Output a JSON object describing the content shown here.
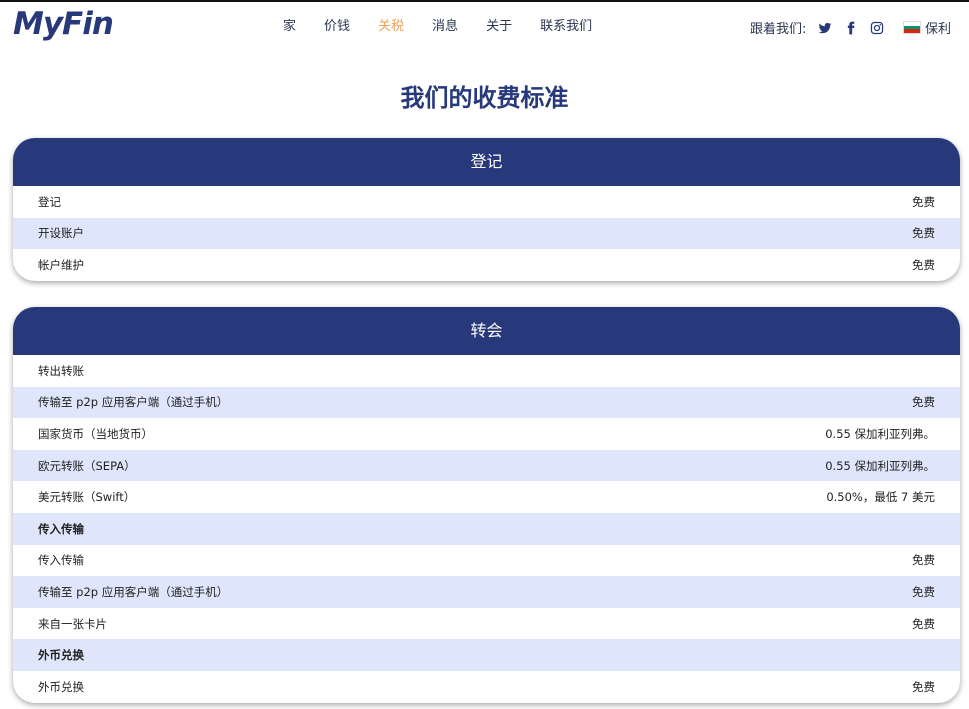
{
  "brand": {
    "logo": "MyFin"
  },
  "nav": {
    "items": [
      "家",
      "价钱",
      "关税",
      "消息",
      "关于",
      "联系我们"
    ],
    "active_index": 2
  },
  "follow": {
    "label": "跟着我们:",
    "icons": [
      "twitter-icon",
      "facebook-icon",
      "instagram-icon"
    ]
  },
  "language": {
    "label": "保利",
    "flag_colors": [
      "#ffffff",
      "#00966e",
      "#d62612"
    ]
  },
  "page": {
    "title": "我们的收费标准"
  },
  "colors": {
    "brand": "#27397a",
    "active_nav": "#f0a35a",
    "row_alt": "#dfe6fb"
  },
  "cards": [
    {
      "title": "登记",
      "rows": [
        {
          "label": "登记",
          "value": "免费"
        },
        {
          "label": "开设账户",
          "value": "免费"
        },
        {
          "label": "帐户维护",
          "value": "免费"
        }
      ]
    },
    {
      "title": "转会",
      "rows": [
        {
          "label": "转出转账",
          "value": "",
          "section": false
        },
        {
          "label": "传输至 p2p 应用客户端（通过手机）",
          "value": "免费"
        },
        {
          "label": "国家货币（当地货币）",
          "value": "0.55 保加利亚列弗。"
        },
        {
          "label": "欧元转账（SEPA）",
          "value": "0.55 保加利亚列弗。"
        },
        {
          "label": "美元转账（Swift）",
          "value": "0.50%，最低 7 美元"
        },
        {
          "label": "传入传输",
          "value": "",
          "section": true
        },
        {
          "label": "传入传输",
          "value": "免费"
        },
        {
          "label": "传输至 p2p 应用客户端（通过手机）",
          "value": "免费"
        },
        {
          "label": "来自一张卡片",
          "value": "免费"
        },
        {
          "label": "外币兑换",
          "value": "",
          "section": true
        },
        {
          "label": "外币兑换",
          "value": "免费"
        }
      ]
    }
  ]
}
